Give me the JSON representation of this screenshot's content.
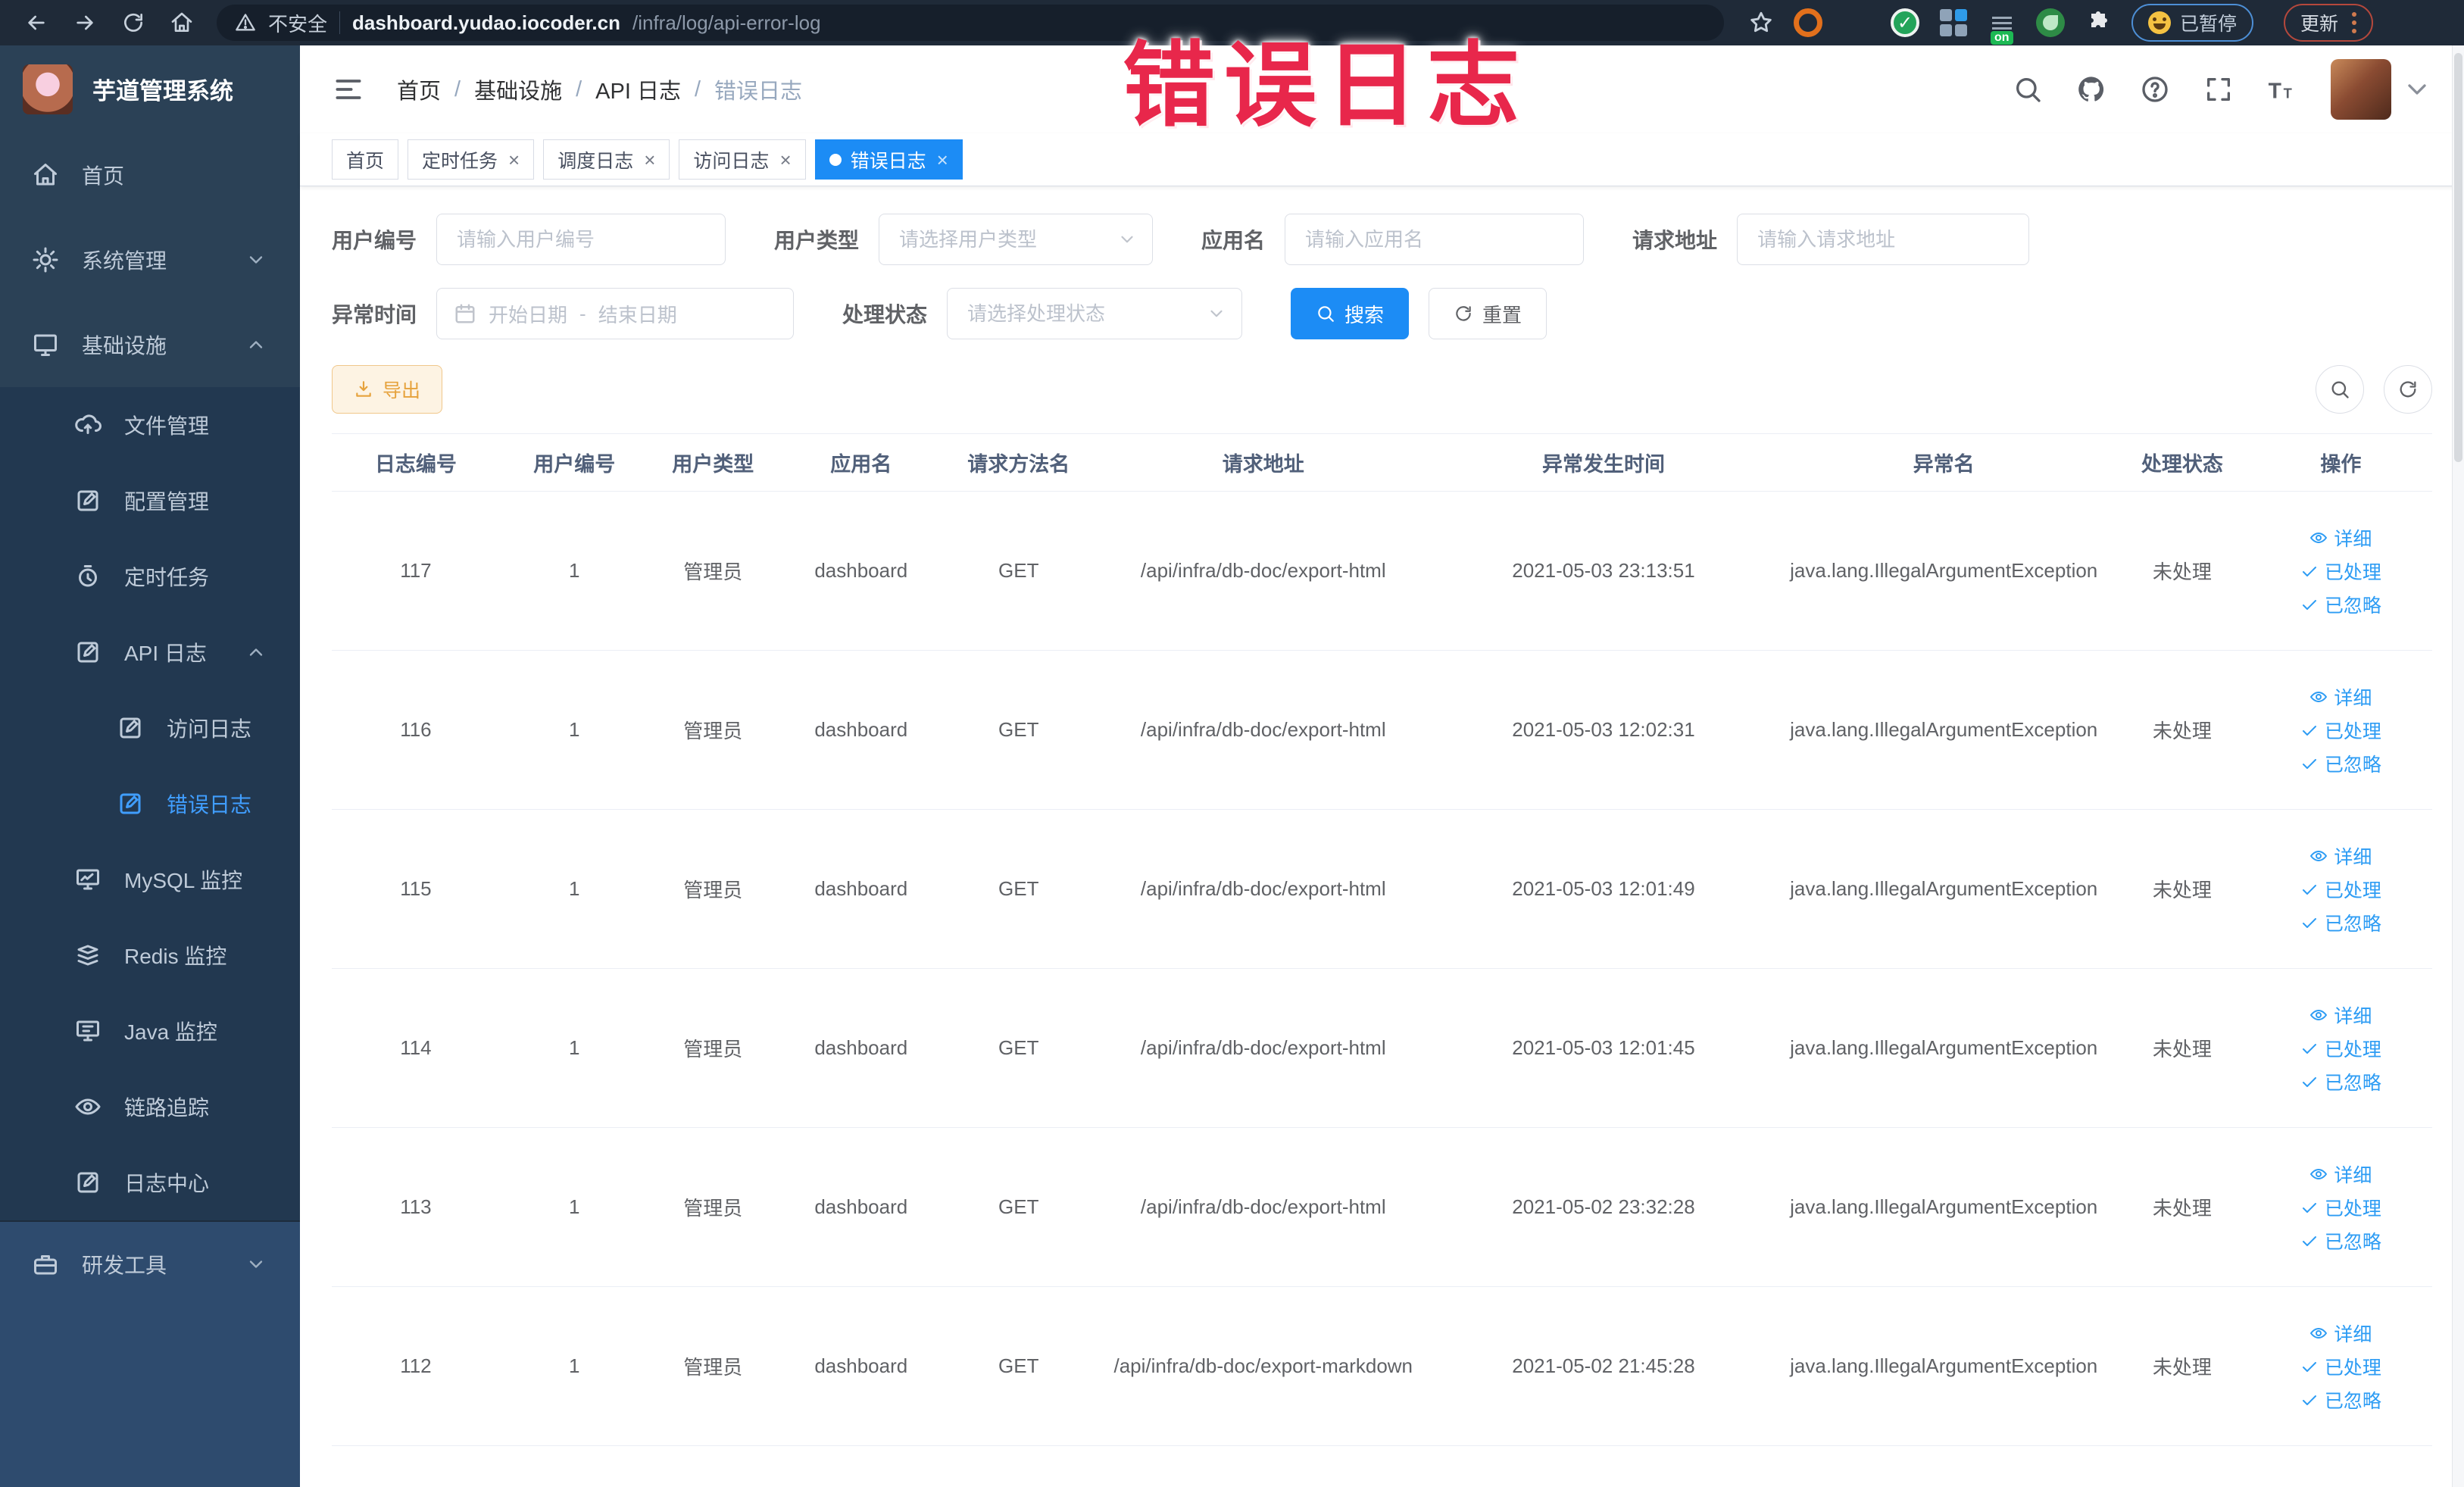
{
  "watermark": {
    "text": "错误日志",
    "color": "#e8274b"
  },
  "browser": {
    "security_label": "不安全",
    "url_host": "dashboard.yudao.iocoder.cn",
    "url_path": "/infra/log/api-error-log",
    "paused_label": "已暂停",
    "update_label": "更新",
    "extension_badge": "on"
  },
  "sidebar": {
    "logo_title": "芋道管理系统",
    "items": [
      {
        "key": "home",
        "label": "首页",
        "icon": "home-icon",
        "level": 0,
        "section": "top",
        "expand": null,
        "active": false
      },
      {
        "key": "system",
        "label": "系统管理",
        "icon": "gear-icon",
        "level": 0,
        "section": "top",
        "expand": "down",
        "active": false
      },
      {
        "key": "infra",
        "label": "基础设施",
        "icon": "monitor-icon",
        "level": 0,
        "section": "top",
        "expand": "up",
        "active": false
      },
      {
        "key": "file",
        "label": "文件管理",
        "icon": "cloud-upload-icon",
        "level": 1,
        "section": "sub",
        "expand": null,
        "active": false
      },
      {
        "key": "config",
        "label": "配置管理",
        "icon": "edit-icon",
        "level": 1,
        "section": "sub",
        "expand": null,
        "active": false
      },
      {
        "key": "job",
        "label": "定时任务",
        "icon": "timer-icon",
        "level": 1,
        "section": "sub",
        "expand": null,
        "active": false
      },
      {
        "key": "api-log",
        "label": "API 日志",
        "icon": "edit-icon",
        "level": 1,
        "section": "sub",
        "expand": "up",
        "active": false
      },
      {
        "key": "access-log",
        "label": "访问日志",
        "icon": "edit-icon",
        "level": 2,
        "section": "sub",
        "expand": null,
        "active": false
      },
      {
        "key": "error-log",
        "label": "错误日志",
        "icon": "edit-icon",
        "level": 2,
        "section": "sub",
        "expand": null,
        "active": true
      },
      {
        "key": "mysql",
        "label": "MySQL 监控",
        "icon": "mysql-icon",
        "level": 1,
        "section": "sub",
        "expand": null,
        "active": false
      },
      {
        "key": "redis",
        "label": "Redis 监控",
        "icon": "redis-icon",
        "level": 1,
        "section": "sub",
        "expand": null,
        "active": false
      },
      {
        "key": "java",
        "label": "Java 监控",
        "icon": "java-icon",
        "level": 1,
        "section": "sub",
        "expand": null,
        "active": false
      },
      {
        "key": "trace",
        "label": "链路追踪",
        "icon": "eye-icon",
        "level": 1,
        "section": "sub",
        "expand": null,
        "active": false
      },
      {
        "key": "log-center",
        "label": "日志中心",
        "icon": "edit-icon",
        "level": 1,
        "section": "sub",
        "expand": null,
        "active": false
      },
      {
        "key": "dev-tools",
        "label": "研发工具",
        "icon": "briefcase-icon",
        "level": 0,
        "section": "bottom",
        "expand": "down",
        "active": false
      }
    ]
  },
  "breadcrumb": {
    "items": [
      "首页",
      "基础设施",
      "API 日志",
      "错误日志"
    ]
  },
  "tags": [
    {
      "label": "首页",
      "closable": false,
      "active": false
    },
    {
      "label": "定时任务",
      "closable": true,
      "active": false
    },
    {
      "label": "调度日志",
      "closable": true,
      "active": false
    },
    {
      "label": "访问日志",
      "closable": true,
      "active": false
    },
    {
      "label": "错误日志",
      "closable": true,
      "active": true
    }
  ],
  "filters": {
    "user_id": {
      "label": "用户编号",
      "placeholder": "请输入用户编号"
    },
    "user_type": {
      "label": "用户类型",
      "placeholder": "请选择用户类型"
    },
    "app_name": {
      "label": "应用名",
      "placeholder": "请输入应用名"
    },
    "request_url": {
      "label": "请求地址",
      "placeholder": "请输入请求地址"
    },
    "exception_time": {
      "label": "异常时间",
      "start_placeholder": "开始日期",
      "separator": "-",
      "end_placeholder": "结束日期"
    },
    "process_status": {
      "label": "处理状态",
      "placeholder": "请选择处理状态"
    },
    "search_button": "搜索",
    "reset_button": "重置"
  },
  "toolbar": {
    "export_button": "导出"
  },
  "table": {
    "columns": [
      "日志编号",
      "用户编号",
      "用户类型",
      "应用名",
      "请求方法名",
      "请求地址",
      "异常发生时间",
      "异常名",
      "处理状态",
      "操作"
    ],
    "col_widths": [
      "8%",
      "7.1%",
      "6.1%",
      "8%",
      "7%",
      "16.3%",
      "16.1%",
      "16.3%",
      "6.4%",
      "8.7%"
    ],
    "actions": [
      "详细",
      "已处理",
      "已忽略"
    ],
    "rows": [
      {
        "id": "117",
        "user_id": "1",
        "user_type": "管理员",
        "app": "dashboard",
        "method": "GET",
        "url": "/api/infra/db-doc/export-html",
        "time": "2021-05-03 23:13:51",
        "exception": "java.lang.IllegalArgumentException",
        "status": "未处理"
      },
      {
        "id": "116",
        "user_id": "1",
        "user_type": "管理员",
        "app": "dashboard",
        "method": "GET",
        "url": "/api/infra/db-doc/export-html",
        "time": "2021-05-03 12:02:31",
        "exception": "java.lang.IllegalArgumentException",
        "status": "未处理"
      },
      {
        "id": "115",
        "user_id": "1",
        "user_type": "管理员",
        "app": "dashboard",
        "method": "GET",
        "url": "/api/infra/db-doc/export-html",
        "time": "2021-05-03 12:01:49",
        "exception": "java.lang.IllegalArgumentException",
        "status": "未处理"
      },
      {
        "id": "114",
        "user_id": "1",
        "user_type": "管理员",
        "app": "dashboard",
        "method": "GET",
        "url": "/api/infra/db-doc/export-html",
        "time": "2021-05-03 12:01:45",
        "exception": "java.lang.IllegalArgumentException",
        "status": "未处理"
      },
      {
        "id": "113",
        "user_id": "1",
        "user_type": "管理员",
        "app": "dashboard",
        "method": "GET",
        "url": "/api/infra/db-doc/export-html",
        "time": "2021-05-02 23:32:28",
        "exception": "java.lang.IllegalArgumentException",
        "status": "未处理"
      },
      {
        "id": "112",
        "user_id": "1",
        "user_type": "管理员",
        "app": "dashboard",
        "method": "GET",
        "url": "/api/infra/db-doc/export-markdown",
        "time": "2021-05-02 21:45:28",
        "exception": "java.lang.IllegalArgumentException",
        "status": "未处理"
      }
    ]
  },
  "colors": {
    "accent": "#409eff",
    "active_tag": "#1c8cf5",
    "warning": "#e6a23c",
    "sidebar_bg": "#2b4156",
    "submenu_bg": "#223850",
    "sidebar_bottom_bg": "#2e4b6e"
  }
}
